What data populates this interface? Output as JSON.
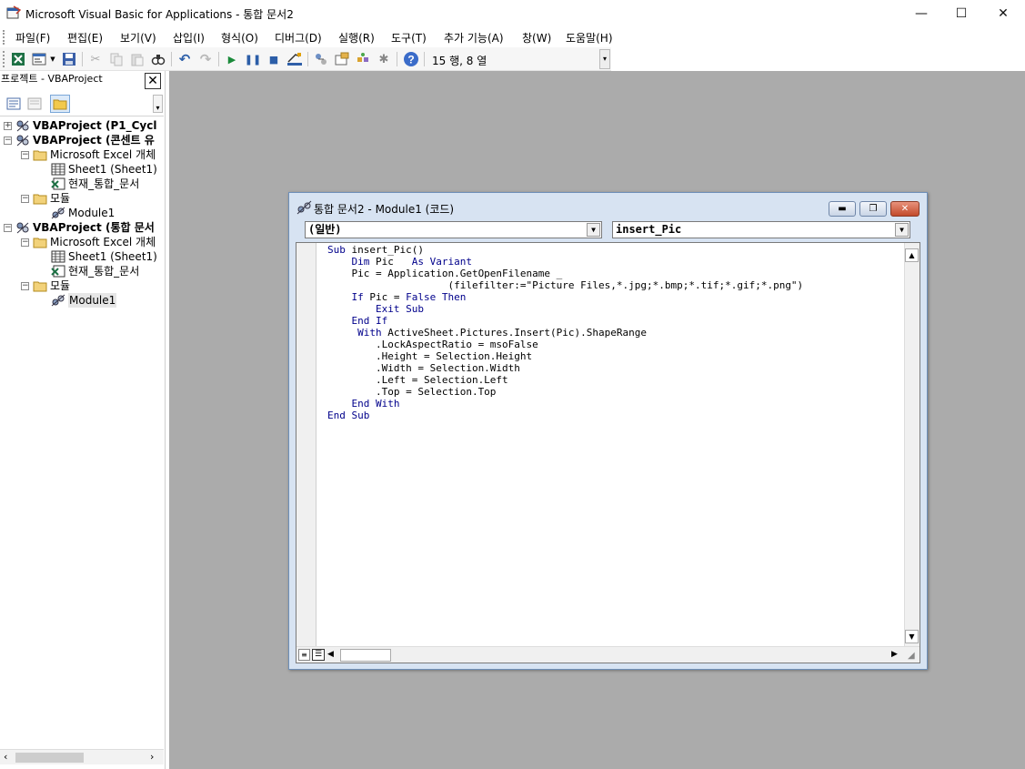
{
  "window": {
    "title": "Microsoft Visual Basic for Applications - 통합 문서2",
    "controls": {
      "minimize": "—",
      "maximize": "☐",
      "close": "✕"
    }
  },
  "menu": {
    "items": [
      "파일(F)",
      "편집(E)",
      "보기(V)",
      "삽입(I)",
      "형식(O)",
      "디버그(D)",
      "실행(R)",
      "도구(T)",
      "추가 기능(A)",
      "창(W)",
      "도움말(H)"
    ]
  },
  "toolbar": {
    "icons": [
      "excel-icon",
      "insert-userform-icon",
      "dropdown-arrow-icon",
      "save-icon",
      "cut-icon",
      "copy-icon",
      "paste-icon",
      "find-icon",
      "undo-icon",
      "redo-icon",
      "run-icon",
      "break-icon",
      "reset-icon",
      "design-mode-icon",
      "project-explorer-icon",
      "properties-icon",
      "object-browser-icon",
      "toolbox-icon",
      "help-icon"
    ],
    "position": "15 행, 8 열"
  },
  "project_panel": {
    "title": "프로젝트 - VBAProject",
    "close": "✕",
    "tree": [
      {
        "label": "VBAProject (P1_Cycl",
        "bold": true,
        "level": 0,
        "expander": "+",
        "icon": "vbaproject-icon"
      },
      {
        "label": "VBAProject (콘센트 유",
        "bold": true,
        "level": 0,
        "expander": "−",
        "icon": "vbaproject-icon"
      },
      {
        "label": "Microsoft Excel 개체",
        "bold": false,
        "level": 1,
        "expander": "−",
        "icon": "folder-icon"
      },
      {
        "label": "Sheet1 (Sheet1)",
        "bold": false,
        "level": 2,
        "expander": "",
        "icon": "sheet-icon"
      },
      {
        "label": "현재_통합_문서",
        "bold": false,
        "level": 2,
        "expander": "",
        "icon": "workbook-icon"
      },
      {
        "label": "모듈",
        "bold": false,
        "level": 1,
        "expander": "−",
        "icon": "folder-icon"
      },
      {
        "label": "Module1",
        "bold": false,
        "level": 2,
        "expander": "",
        "icon": "module-icon"
      },
      {
        "label": "VBAProject (통합 문서",
        "bold": true,
        "level": 0,
        "expander": "−",
        "icon": "vbaproject-icon"
      },
      {
        "label": "Microsoft Excel 개체",
        "bold": false,
        "level": 1,
        "expander": "−",
        "icon": "folder-icon"
      },
      {
        "label": "Sheet1 (Sheet1)",
        "bold": false,
        "level": 2,
        "expander": "",
        "icon": "sheet-icon"
      },
      {
        "label": "현재_통합_문서",
        "bold": false,
        "level": 2,
        "expander": "",
        "icon": "workbook-icon"
      },
      {
        "label": "모듈",
        "bold": false,
        "level": 1,
        "expander": "−",
        "icon": "folder-icon"
      },
      {
        "label": "Module1",
        "bold": false,
        "level": 2,
        "expander": "",
        "icon": "module-icon",
        "selected": true
      }
    ]
  },
  "code_window": {
    "title": "통합 문서2 - Module1 (코드)",
    "object_combo": "(일반)",
    "procedure_combo": "insert_Pic",
    "code_lines": [
      "Sub insert_Pic()",
      "    Dim Pic   As Variant",
      "    Pic = Application.GetOpenFilename _",
      "                    (filefilter:=\"Picture Files,*.jpg;*.bmp;*.tif;*.gif;*.png\")",
      "    If Pic = False Then",
      "        Exit Sub",
      "    End If",
      "     With ActiveSheet.Pictures.Insert(Pic).ShapeRange",
      "        .LockAspectRatio = msoFalse",
      "        .Height = Selection.Height",
      "        .Width = Selection.Width",
      "        .Left = Selection.Left",
      "        .Top = Selection.Top",
      "    End With",
      "End Sub"
    ]
  },
  "colors": {
    "mdi_background": "#ababab",
    "keyword": "#00008b",
    "code_window_frame": "#d7e3f2"
  }
}
